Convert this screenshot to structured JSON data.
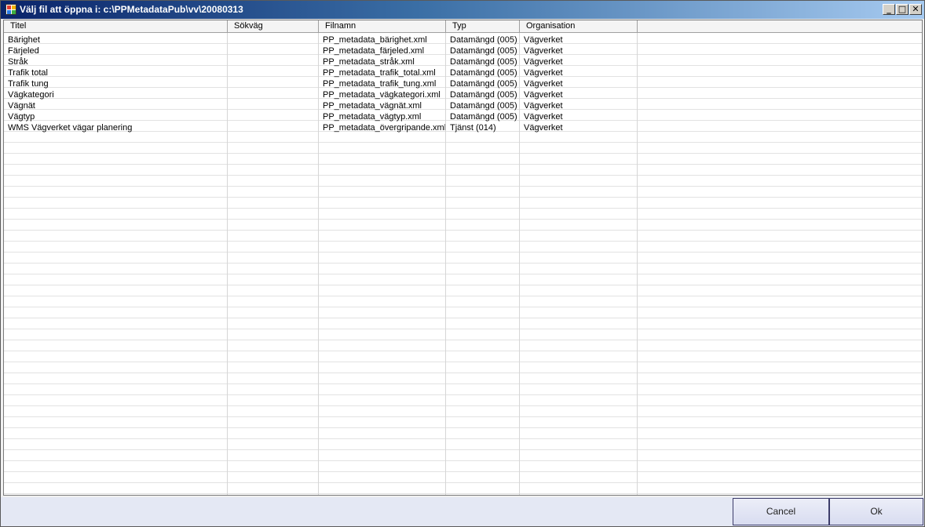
{
  "window": {
    "title": "Välj fil att öppna i:  c:\\PPMetadataPub\\vv\\20080313",
    "controls": {
      "minimize": "_",
      "maximize": "□",
      "close": "✕"
    }
  },
  "table": {
    "columns": [
      "Titel",
      "Sökväg",
      "Filnamn",
      "Typ",
      "Organisation"
    ],
    "rows": [
      {
        "titel": "Bärighet",
        "sokvag": "",
        "filnamn": "PP_metadata_bärighet.xml",
        "typ": "Datamängd (005)",
        "organisation": "Vägverket"
      },
      {
        "titel": "Färjeled",
        "sokvag": "",
        "filnamn": "PP_metadata_färjeled.xml",
        "typ": "Datamängd (005)",
        "organisation": "Vägverket"
      },
      {
        "titel": "Stråk",
        "sokvag": "",
        "filnamn": "PP_metadata_stråk.xml",
        "typ": "Datamängd (005)",
        "organisation": "Vägverket"
      },
      {
        "titel": "Trafik total",
        "sokvag": "",
        "filnamn": "PP_metadata_trafik_total.xml",
        "typ": "Datamängd (005)",
        "organisation": "Vägverket"
      },
      {
        "titel": "Trafik tung",
        "sokvag": "",
        "filnamn": "PP_metadata_trafik_tung.xml",
        "typ": "Datamängd (005)",
        "organisation": "Vägverket"
      },
      {
        "titel": "Vägkategori",
        "sokvag": "",
        "filnamn": "PP_metadata_vägkategori.xml",
        "typ": "Datamängd (005)",
        "organisation": "Vägverket"
      },
      {
        "titel": "Vägnät",
        "sokvag": "",
        "filnamn": "PP_metadata_vägnät.xml",
        "typ": "Datamängd (005)",
        "organisation": "Vägverket"
      },
      {
        "titel": "Vägtyp",
        "sokvag": "",
        "filnamn": "PP_metadata_vägtyp.xml",
        "typ": "Datamängd (005)",
        "organisation": "Vägverket"
      },
      {
        "titel": "WMS Vägverket vägar planering",
        "sokvag": "",
        "filnamn": "PP_metadata_övergripande.xml",
        "typ": "Tjänst (014)",
        "organisation": "Vägverket"
      }
    ]
  },
  "buttons": {
    "cancel": "Cancel",
    "ok": "Ok"
  }
}
